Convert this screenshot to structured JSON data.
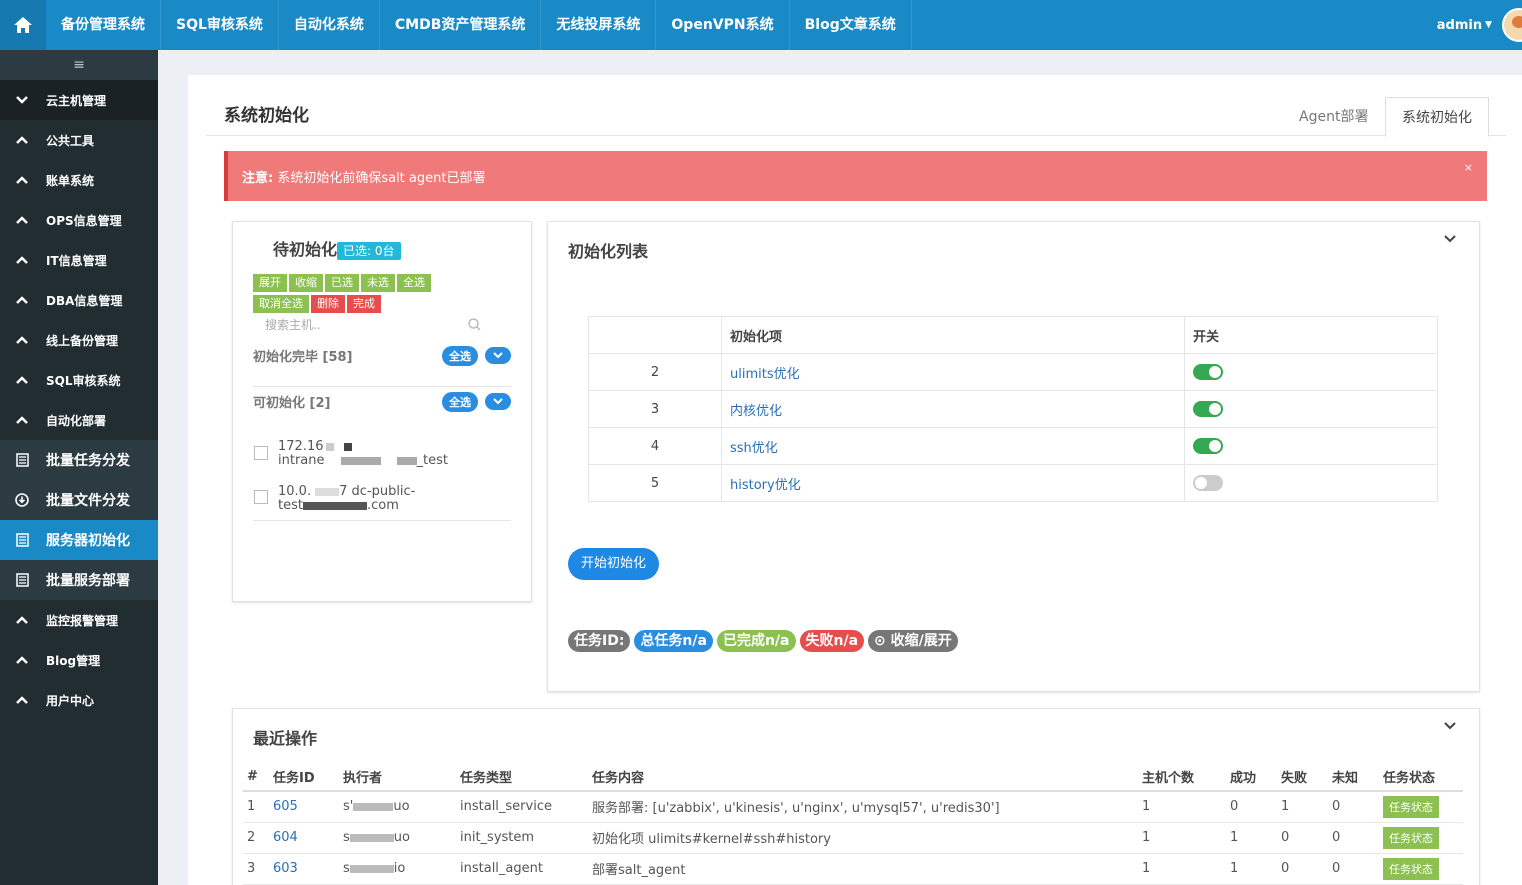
{
  "topnav": {
    "items": [
      "备份管理系统",
      "SQL审核系统",
      "自动化系统",
      "CMDB资产管理系统",
      "无线投屏系统",
      "OpenVPN系统",
      "Blog文章系统"
    ],
    "user": "admin",
    "accent": "#1a8ac7"
  },
  "sidebar": {
    "toggle": "≡",
    "items": [
      {
        "label": "云主机管理",
        "icon": "chevron-down-icon"
      },
      {
        "label": "公共工具",
        "icon": "chevron-up-icon"
      },
      {
        "label": "账单系统",
        "icon": "chevron-up-icon"
      },
      {
        "label": "OPS信息管理",
        "icon": "chevron-up-icon"
      },
      {
        "label": "IT信息管理",
        "icon": "chevron-up-icon"
      },
      {
        "label": "DBA信息管理",
        "icon": "chevron-up-icon"
      },
      {
        "label": "线上备份管理",
        "icon": "chevron-up-icon"
      },
      {
        "label": "SQL审核系统",
        "icon": "chevron-up-icon"
      },
      {
        "label": "自动化部署",
        "icon": "chevron-up-icon"
      },
      {
        "label": "批量任务分发",
        "icon": "list-icon"
      },
      {
        "label": "批量文件分发",
        "icon": "download-icon"
      },
      {
        "label": "服务器初始化",
        "icon": "list-icon"
      },
      {
        "label": "批量服务部署",
        "icon": "list-icon"
      },
      {
        "label": "监控报警管理",
        "icon": "chevron-up-icon"
      },
      {
        "label": "Blog管理",
        "icon": "chevron-up-icon"
      },
      {
        "label": "用户中心",
        "icon": "chevron-up-icon"
      }
    ]
  },
  "page": {
    "title": "系统初始化",
    "tabs": [
      "Agent部署",
      "系统初始化"
    ]
  },
  "alert": {
    "prefix": "注意:",
    "text": " 系统初始化前确保salt agent已部署",
    "close": "×"
  },
  "pending": {
    "title": "待初始化",
    "selected_badge": "已选: 0台",
    "buttons_row1": [
      "展开",
      "收缩",
      "已选",
      "未选",
      "全选"
    ],
    "buttons_row2": [
      "取消全选",
      "删除",
      "完成"
    ],
    "search_placeholder": "搜索主机..",
    "group_done": "初始化完毕 [58]",
    "group_ready": "可初始化 [2]",
    "select_all": "全选",
    "hosts": [
      {
        "line1": "172.16",
        "line2a": "intrane",
        "line2b": "_test"
      },
      {
        "line1a": "10.0.",
        "line1b": "7 dc-public-",
        "line2a": "test",
        "line2b": ".com"
      }
    ]
  },
  "init_list": {
    "title": "初始化列表",
    "headers": [
      "",
      "初始化项",
      "开关"
    ],
    "rows": [
      {
        "num": "2",
        "name": "ulimits优化",
        "on": true
      },
      {
        "num": "3",
        "name": "内核优化",
        "on": true
      },
      {
        "num": "4",
        "name": "ssh优化",
        "on": true
      },
      {
        "num": "5",
        "name": "history优化",
        "on": false
      }
    ],
    "start_button": "开始初始化",
    "tags": [
      "任务ID:",
      "总任务n/a",
      "已完成n/a",
      "失败n/a",
      "收缩/展开"
    ]
  },
  "recent": {
    "title": "最近操作",
    "headers": [
      "#",
      "任务ID",
      "执行者",
      "任务类型",
      "任务内容",
      "主机个数",
      "成功",
      "失败",
      "未知",
      "任务状态"
    ],
    "rows": [
      {
        "idx": "1",
        "id": "605",
        "user_a": "s'",
        "user_b": "uo",
        "type": "install_service",
        "content": "服务部署: [u'zabbix', u'kinesis', u'nginx', u'mysql57', u'redis30']",
        "hosts": "1",
        "ok": "0",
        "fail": "1",
        "unknown": "0",
        "status": "任务状态"
      },
      {
        "idx": "2",
        "id": "604",
        "user_a": "s",
        "user_b": "uo",
        "type": "init_system",
        "content": "初始化项 ulimits#kernel#ssh#history",
        "hosts": "1",
        "ok": "1",
        "fail": "0",
        "unknown": "0",
        "status": "任务状态"
      },
      {
        "idx": "3",
        "id": "603",
        "user_a": "s",
        "user_b": "io",
        "type": "install_agent",
        "content": "部署salt_agent",
        "hosts": "1",
        "ok": "1",
        "fail": "0",
        "unknown": "0",
        "status": "任务状态"
      }
    ]
  }
}
